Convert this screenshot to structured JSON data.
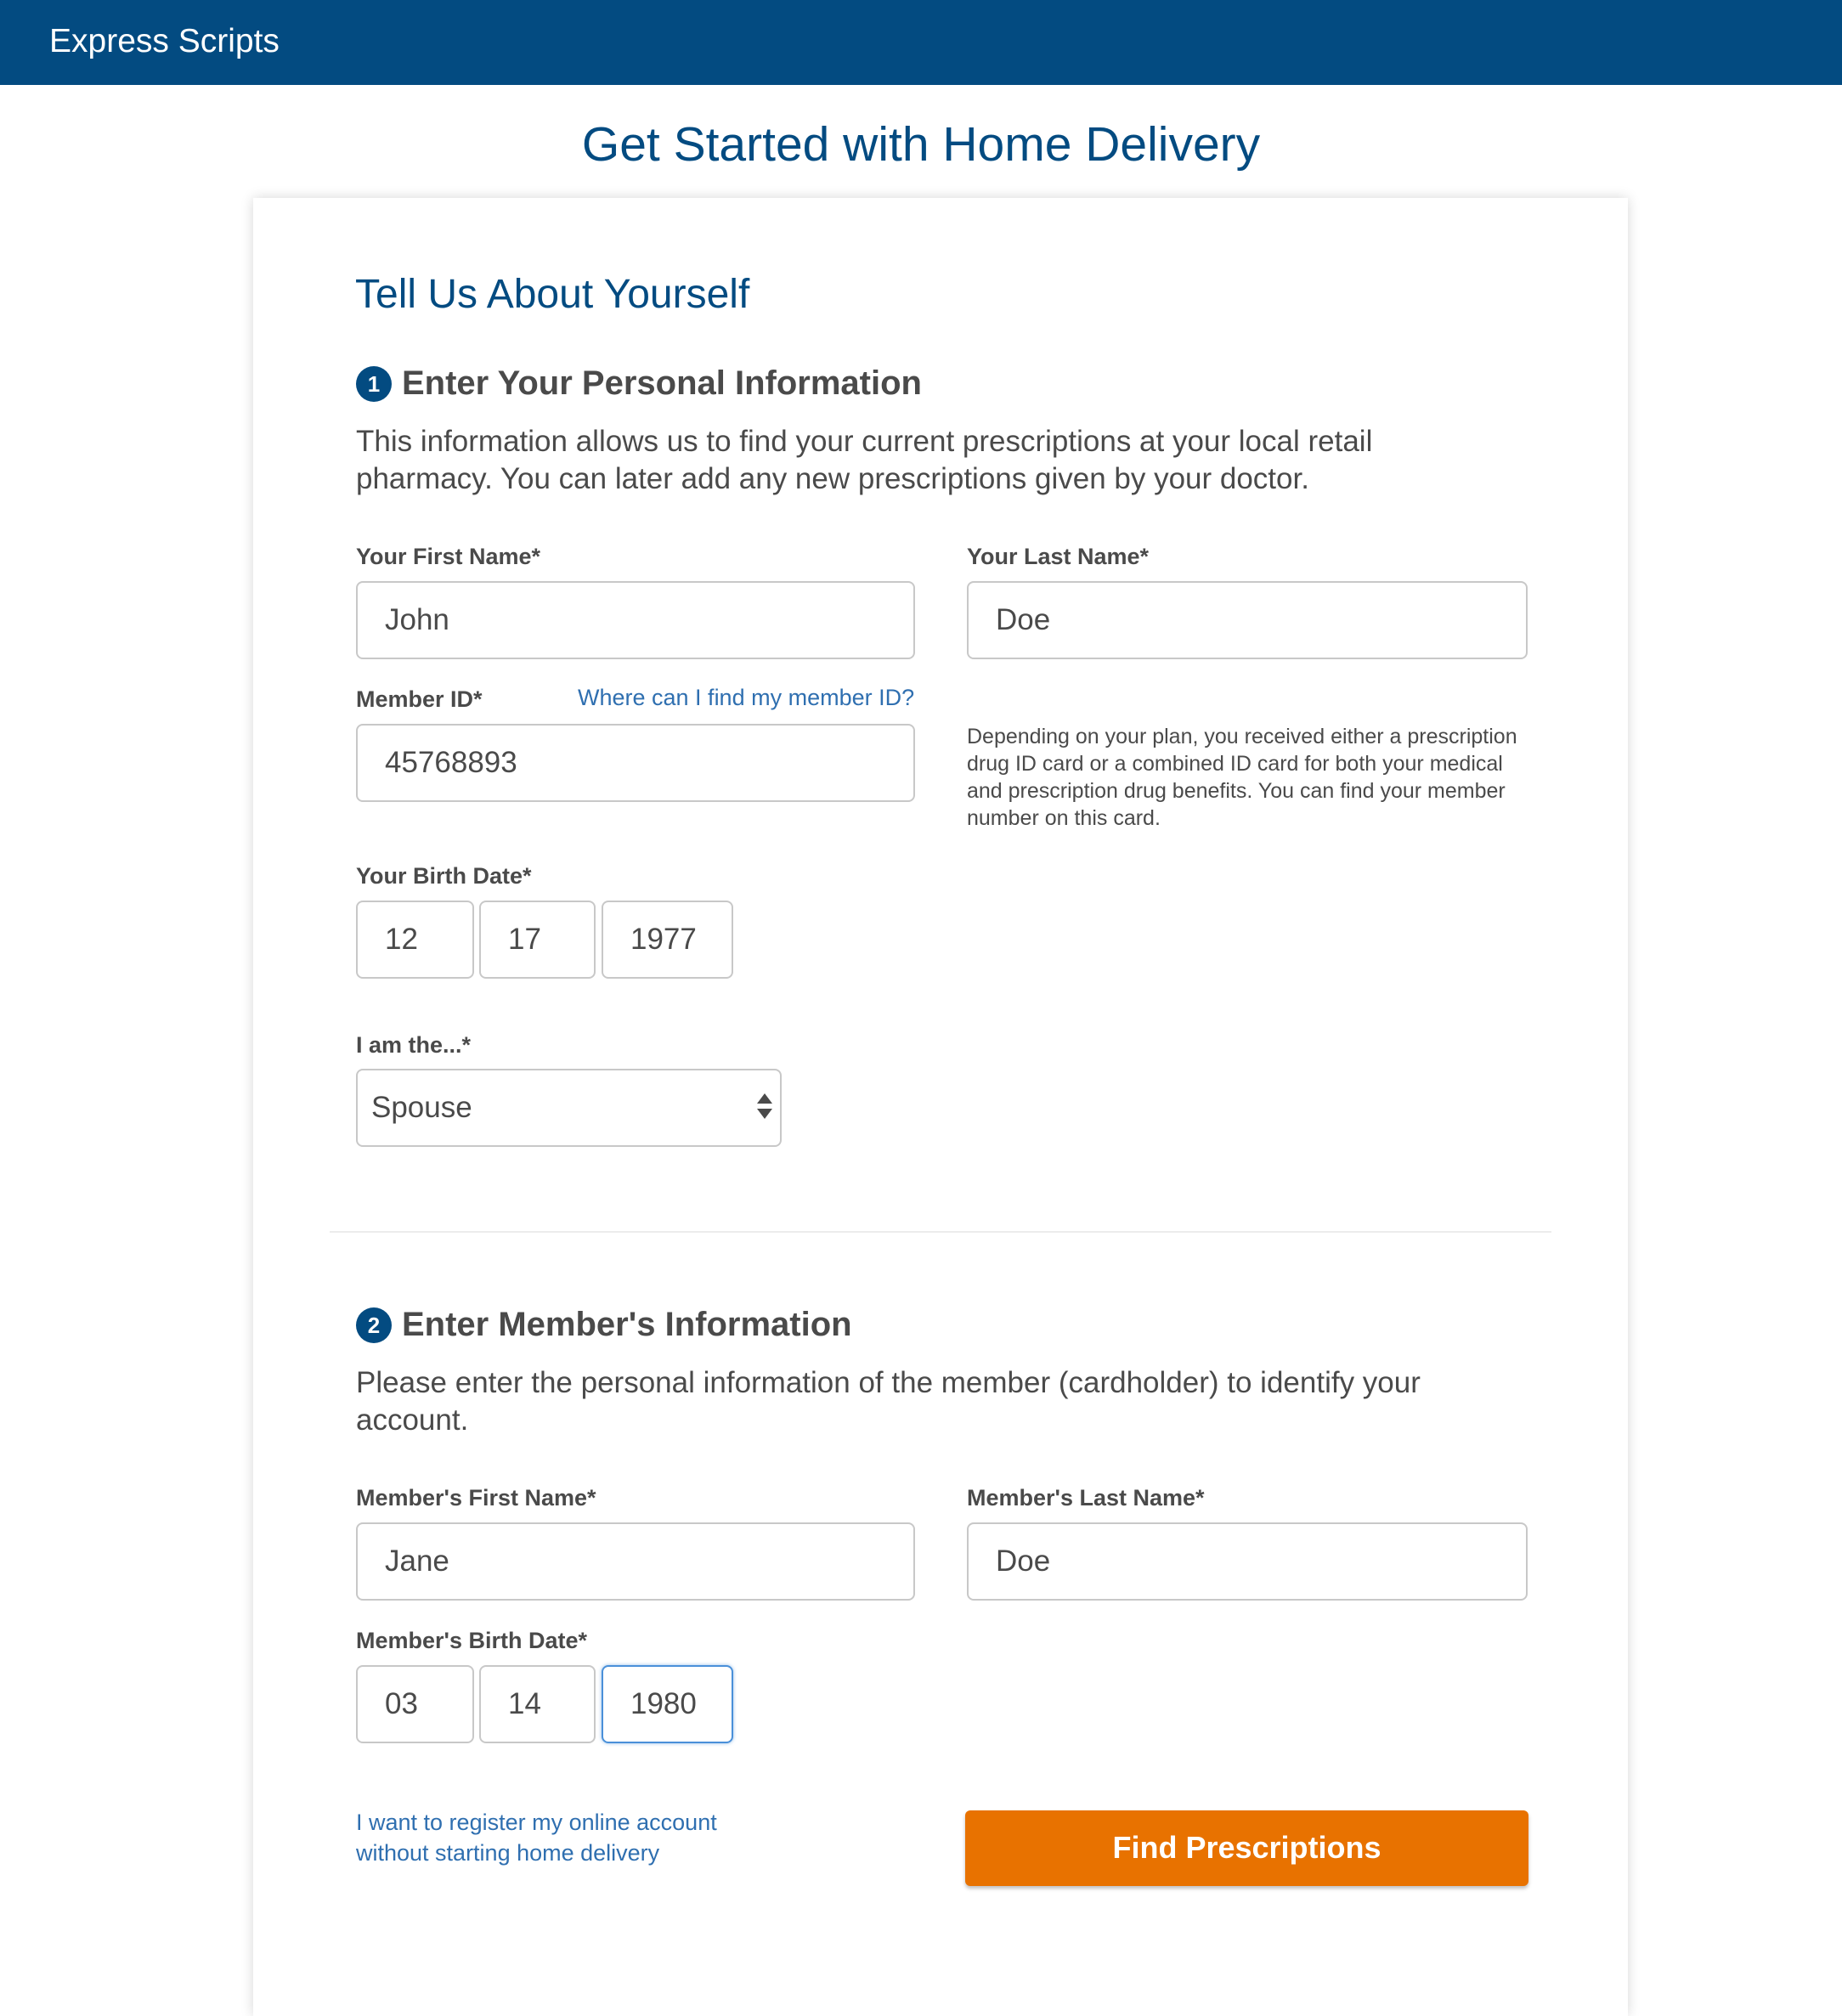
{
  "header": {
    "brand": "Express Scripts"
  },
  "page_title": "Get Started with Home Delivery",
  "form": {
    "title": "Tell Us About Yourself",
    "step1": {
      "number": "1",
      "heading": "Enter Your Personal Information",
      "description": "This information allows us to find your current prescriptions at your local retail pharmacy. You can later add any new prescriptions given by your doctor.",
      "first_name_label": "Your First Name*",
      "first_name_value": "John",
      "last_name_label": "Your Last Name*",
      "last_name_value": "Doe",
      "member_id_label": "Member ID*",
      "member_id_link": "Where can I find my member ID?",
      "member_id_value": "45768893",
      "member_id_help": "Depending on your plan, you received either a prescription drug ID card or a combined ID card for both your medical and prescription drug benefits. You can find your member number on this card.",
      "birth_date_label": "Your Birth Date*",
      "birth_month": "12",
      "birth_day": "17",
      "birth_year": "1977",
      "relationship_label": "I am the...*",
      "relationship_value": "Spouse"
    },
    "step2": {
      "number": "2",
      "heading": "Enter Member's Information",
      "description": "Please enter the personal information of the member (cardholder) to identify your account.",
      "first_name_label": "Member's First Name*",
      "first_name_value": "Jane",
      "last_name_label": "Member's Last Name*",
      "last_name_value": "Doe",
      "birth_date_label": "Member's Birth Date*",
      "birth_month": "03",
      "birth_day": "14",
      "birth_year": "1980"
    },
    "register_link": "I want to register my online account without starting home delivery",
    "submit_label": "Find Prescriptions"
  },
  "colors": {
    "brand_blue": "#034b81",
    "link_blue": "#2f6fb0",
    "button_orange": "#e87200",
    "focus_blue": "#4a90d9"
  },
  "icons": {
    "select_arrows": "up-down-caret-icon",
    "step_badges": "numbered-circle-icon"
  }
}
